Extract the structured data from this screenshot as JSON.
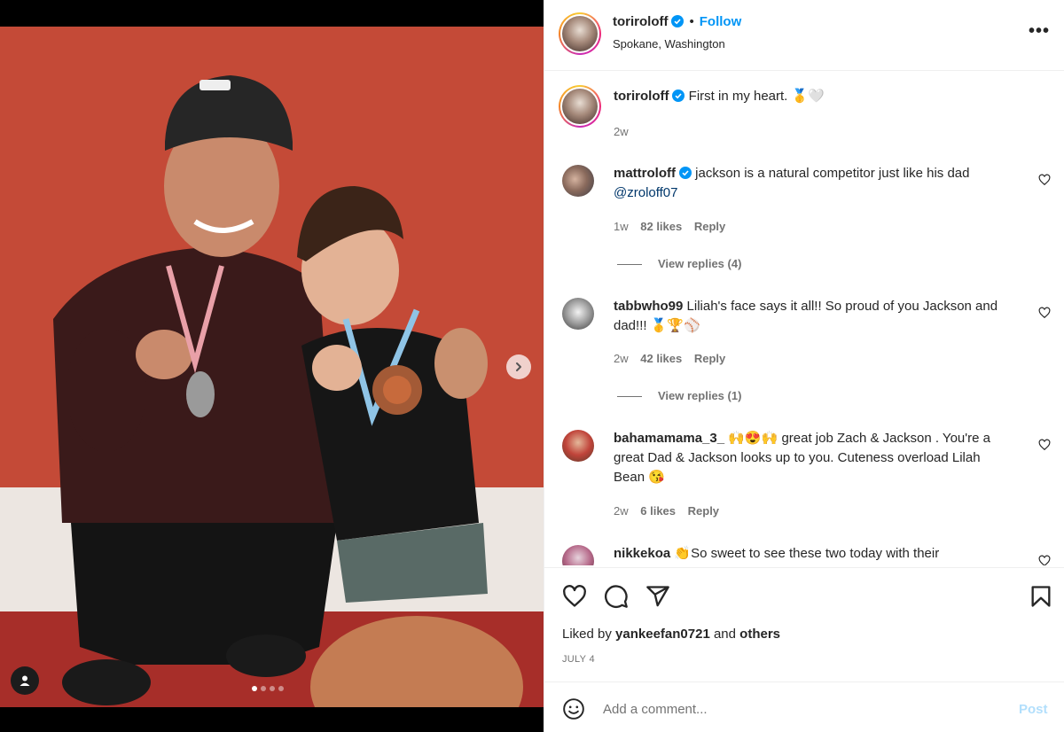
{
  "post": {
    "username": "toriroloff",
    "follow_label": "Follow",
    "separator": "•",
    "location": "Spokane, Washington",
    "more_label": "•••"
  },
  "caption": {
    "username": "toriroloff",
    "text": "First in my heart. 🥇🤍",
    "time": "2w"
  },
  "comments": [
    {
      "username": "mattroloff",
      "verified": true,
      "text": "jackson is a natural competitor just like his dad ",
      "mention": "@zroloff07",
      "time": "1w",
      "likes": "82 likes",
      "reply": "Reply",
      "view_replies": "View replies (4)"
    },
    {
      "username": "tabbwho99",
      "text": "Liliah's face says it all!! So proud of you Jackson and dad!!! 🥇🏆⚾",
      "time": "2w",
      "likes": "42 likes",
      "reply": "Reply",
      "view_replies": "View replies (1)"
    },
    {
      "username": "bahamamama_3_",
      "text": "🙌😍🙌 great job Zach & Jackson . You're a great Dad & Jackson looks up to you. Cuteness overload Lilah Bean 😘",
      "time": "2w",
      "likes": "6 likes",
      "reply": "Reply"
    },
    {
      "username": "nikkekoa",
      "text": "👏So sweet to see these two today with their"
    }
  ],
  "actions": {
    "liked_by_prefix": "Liked by ",
    "liked_by_user": "yankeefan0721",
    "liked_by_and": " and ",
    "liked_by_others": "others",
    "date": "JULY 4"
  },
  "add_comment": {
    "placeholder": "Add a comment...",
    "post_label": "Post"
  },
  "carousel": {
    "slide_count": 4,
    "active_index": 0
  },
  "colors": {
    "accent": "#0095f6",
    "verified": "#0095f6",
    "muted": "#737373",
    "post_disabled": "#b2dffc"
  },
  "icons": [
    "heart-icon",
    "comment-icon",
    "share-icon",
    "bookmark-icon",
    "emoji-icon",
    "chevron-right-icon",
    "user-tag-icon",
    "verified-badge-icon",
    "more-icon"
  ]
}
